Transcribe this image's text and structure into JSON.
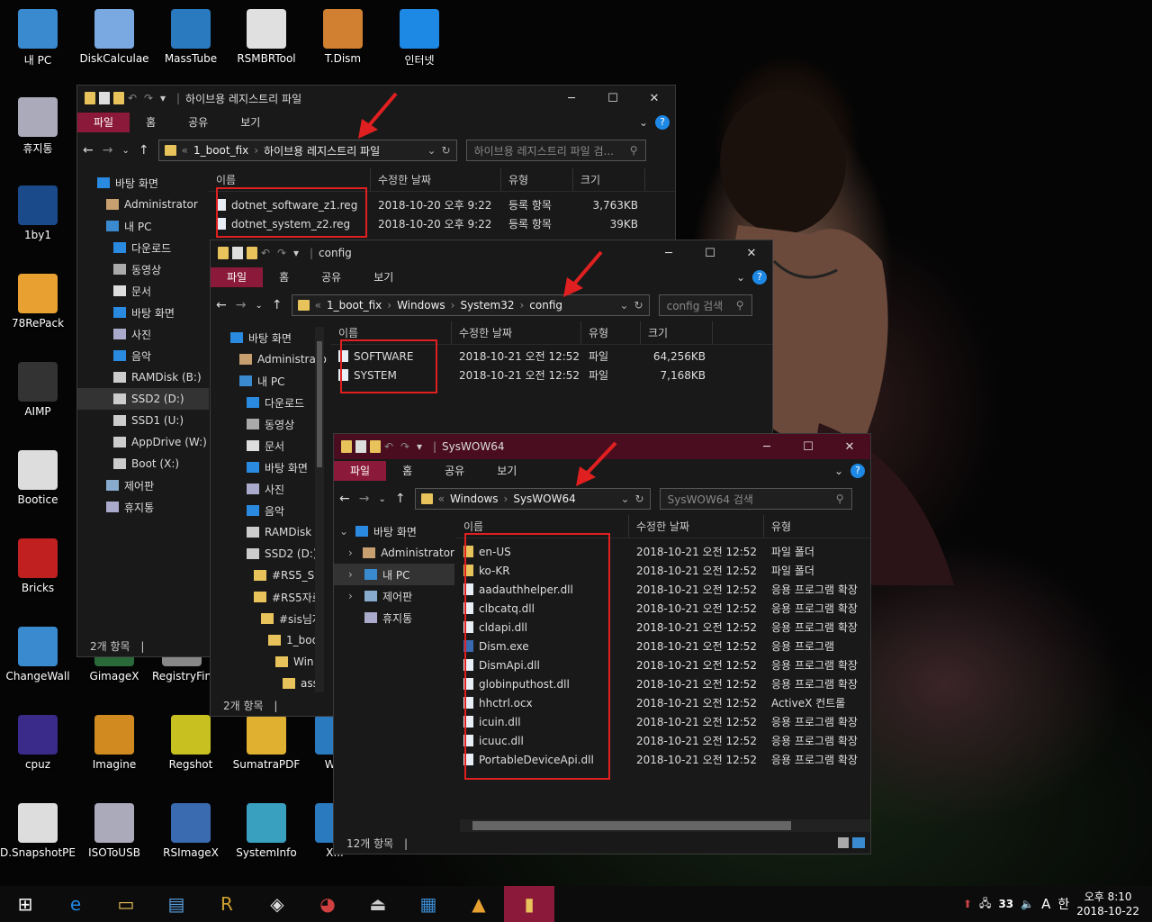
{
  "desktop_icons": [
    {
      "label": "내 PC",
      "icon": "computer-icon"
    },
    {
      "label": "DiskCalculae",
      "icon": "disk-pie-icon"
    },
    {
      "label": "MassTube",
      "icon": "globe-download-icon"
    },
    {
      "label": "RSMBRTool",
      "icon": "rs-icon"
    },
    {
      "label": "T.Dism",
      "icon": "box-disc-icon"
    },
    {
      "label": "인터넷",
      "icon": "ie-icon"
    },
    {
      "label": "휴지통",
      "icon": "recycle-bin-icon"
    },
    {
      "label": "1by1",
      "icon": "1by1-icon"
    },
    {
      "label": "78RePack",
      "icon": "triangle-icon"
    },
    {
      "label": "AIMP",
      "icon": "aimp-icon"
    },
    {
      "label": "Bootice",
      "icon": "bootice-icon"
    },
    {
      "label": "Bricks",
      "icon": "flash-icon"
    },
    {
      "label": "ChangeWall",
      "icon": "paint-icon"
    },
    {
      "label": "GimageX",
      "icon": "gimagex-icon"
    },
    {
      "label": "RegistryFin",
      "icon": "registry-icon"
    },
    {
      "label": "cpuz",
      "icon": "chip-icon"
    },
    {
      "label": "Imagine",
      "icon": "flower-icon"
    },
    {
      "label": "Regshot",
      "icon": "regshot-icon"
    },
    {
      "label": "SumatraPDF",
      "icon": "pdf-icon"
    },
    {
      "label": "Win",
      "icon": "app-icon"
    },
    {
      "label": "D.SnapshotPE",
      "icon": "snapshot-icon"
    },
    {
      "label": "ISOToUSB",
      "icon": "usb-icon"
    },
    {
      "label": "RSImageX",
      "icon": "rsimagex-icon"
    },
    {
      "label": "SystemInfo",
      "icon": "sysinfo-icon"
    },
    {
      "label": "X...",
      "icon": "app-icon"
    }
  ],
  "win1": {
    "title": "하이브용 레지스트리 파일",
    "tabs": [
      "파일",
      "홈",
      "공유",
      "보기"
    ],
    "path": [
      "1_boot_fix",
      "하이브용 레지스트리 파일"
    ],
    "search": "하이브용 레지스트리 파일 검...",
    "columns": [
      "이름",
      "수정한 날짜",
      "유형",
      "크기"
    ],
    "files": [
      {
        "name": "dotnet_software_z1.reg",
        "date": "2018-10-20 오후 9:22",
        "type": "등록 항목",
        "size": "3,763KB"
      },
      {
        "name": "dotnet_system_z2.reg",
        "date": "2018-10-20 오후 9:22",
        "type": "등록 항목",
        "size": "39KB"
      }
    ],
    "nav": [
      "바탕 화면",
      "Administrator",
      "내 PC",
      "다운로드",
      "동영상",
      "문서",
      "바탕 화면",
      "사진",
      "음악",
      "RAMDisk (B:)",
      "SSD2 (D:)",
      "SSD1 (U:)",
      "AppDrive (W:)",
      "Boot (X:)",
      "제어판",
      "휴지통"
    ],
    "status": "2개 항목"
  },
  "win2": {
    "title": "config",
    "tabs": [
      "파일",
      "홈",
      "공유",
      "보기"
    ],
    "path": [
      "1_boot_fix",
      "Windows",
      "System32",
      "config"
    ],
    "search": "config 검색",
    "columns": [
      "이름",
      "수정한 날짜",
      "유형",
      "크기"
    ],
    "files": [
      {
        "name": "SOFTWARE",
        "date": "2018-10-21 오전 12:52",
        "type": "파일",
        "size": "64,256KB"
      },
      {
        "name": "SYSTEM",
        "date": "2018-10-21 오전 12:52",
        "type": "파일",
        "size": "7,168KB"
      }
    ],
    "nav": [
      "바탕 화면",
      "Administrator",
      "내 PC",
      "다운로드",
      "동영상",
      "문서",
      "바탕 화면",
      "사진",
      "음악",
      "RAMDisk",
      "SSD2 (D:)",
      "#RS5_Sy",
      "#RS5자료",
      "#sis님자",
      "1_boo",
      "Win",
      "ass"
    ],
    "status": "2개 항목"
  },
  "win3": {
    "title": "SysWOW64",
    "tabs": [
      "파일",
      "홈",
      "공유",
      "보기"
    ],
    "path": [
      "Windows",
      "SysWOW64"
    ],
    "search": "SysWOW64 검색",
    "columns": [
      "이름",
      "수정한 날짜",
      "유형"
    ],
    "files": [
      {
        "name": "en-US",
        "date": "2018-10-21 오전 12:52",
        "type": "파일 폴더",
        "kind": "folder"
      },
      {
        "name": "ko-KR",
        "date": "2018-10-21 오전 12:52",
        "type": "파일 폴더",
        "kind": "folder"
      },
      {
        "name": "aadauthhelper.dll",
        "date": "2018-10-21 오전 12:52",
        "type": "응용 프로그램 확장",
        "kind": "dll"
      },
      {
        "name": "clbcatq.dll",
        "date": "2018-10-21 오전 12:52",
        "type": "응용 프로그램 확장",
        "kind": "dll"
      },
      {
        "name": "cldapi.dll",
        "date": "2018-10-21 오전 12:52",
        "type": "응용 프로그램 확장",
        "kind": "dll"
      },
      {
        "name": "Dism.exe",
        "date": "2018-10-21 오전 12:52",
        "type": "응용 프로그램",
        "kind": "exe"
      },
      {
        "name": "DismApi.dll",
        "date": "2018-10-21 오전 12:52",
        "type": "응용 프로그램 확장",
        "kind": "dll"
      },
      {
        "name": "globinputhost.dll",
        "date": "2018-10-21 오전 12:52",
        "type": "응용 프로그램 확장",
        "kind": "dll"
      },
      {
        "name": "hhctrl.ocx",
        "date": "2018-10-21 오전 12:52",
        "type": "ActiveX 컨트롤",
        "kind": "dll"
      },
      {
        "name": "icuin.dll",
        "date": "2018-10-21 오전 12:52",
        "type": "응용 프로그램 확장",
        "kind": "dll"
      },
      {
        "name": "icuuc.dll",
        "date": "2018-10-21 오전 12:52",
        "type": "응용 프로그램 확장",
        "kind": "dll"
      },
      {
        "name": "PortableDeviceApi.dll",
        "date": "2018-10-21 오전 12:52",
        "type": "응용 프로그램 확장",
        "kind": "dll"
      }
    ],
    "nav": [
      "바탕 화면",
      "Administrator",
      "내 PC",
      "제어판",
      "휴지통"
    ],
    "status": "12개 항목"
  },
  "taskbar": {
    "apps": [
      "windows-start-icon",
      "ie-icon",
      "file-explorer-icon",
      "notepad-icon",
      "r-app-icon",
      "bootice-icon",
      "paint-icon",
      "usb-drive-icon",
      "changewall-icon",
      "aimp-icon",
      "explorer-active-icon"
    ],
    "tray_number": "33",
    "ime": "A",
    "lang": "한",
    "time": "오후 8:10",
    "date": "2018-10-22"
  },
  "colors": {
    "accent": "#8b1a3a",
    "highlight": "#e02020",
    "folder": "#e8c25a"
  }
}
